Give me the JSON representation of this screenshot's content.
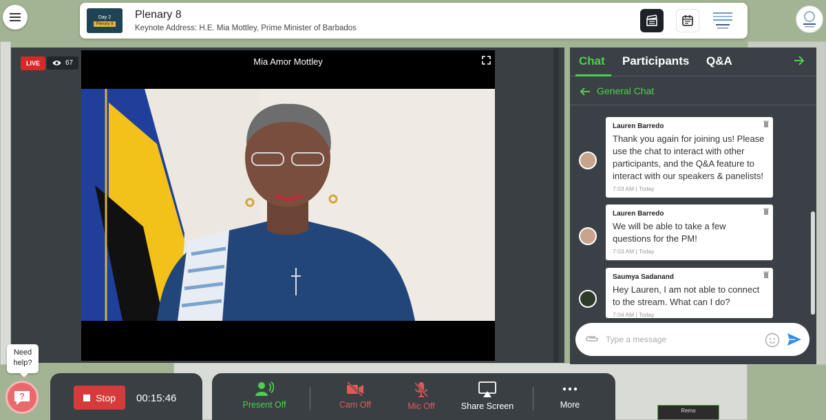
{
  "colors": {
    "accent_green": "#4ccf4c",
    "live_red": "#d52a2a",
    "panel_bg": "#3b4046"
  },
  "header": {
    "thumb_day": "Day 2",
    "thumb_tag": "Plenary 8",
    "title": "Plenary 8",
    "subtitle": "Keynote Address: H.E. Mia Mottley, Prime Minister of Barbados"
  },
  "stage": {
    "live_label": "LIVE",
    "viewer_count": "67",
    "speaker_name": "Mia Amor Mottley"
  },
  "chat": {
    "tabs": [
      "Chat",
      "Participants",
      "Q&A"
    ],
    "active_tab": "Chat",
    "channel": "General Chat",
    "messages": [
      {
        "author": "Lauren Barredo",
        "text": "Thank you again for joining us! Please use the chat to interact with other participants, and the Q&A feature to interact with our speakers & panelists!",
        "time": "7:03 AM | Today"
      },
      {
        "author": "Lauren Barredo",
        "text": "We will be able to take a few questions for the PM!",
        "time": "7:03 AM | Today"
      },
      {
        "author": "Saumya Sadanand",
        "text": "Hey Lauren, I am not able to connect to the stream. What can I do?",
        "time": "7:04 AM | Today"
      }
    ],
    "input_placeholder": "Type a message"
  },
  "help": {
    "label": "Need help?"
  },
  "controls": {
    "stop_label": "Stop",
    "timer": "00:15:46",
    "present": "Present Off",
    "cam": "Cam Off",
    "mic": "Mic Off",
    "share": "Share Screen",
    "more": "More"
  },
  "floor": {
    "tile_label": "Remo"
  },
  "icons": [
    "menu-icon",
    "clapperboard-icon",
    "calendar-icon",
    "eye-icon",
    "expand-icon",
    "arrow-right-icon",
    "arrow-left-icon",
    "trash-icon",
    "paperclip-icon",
    "emoji-icon",
    "send-icon",
    "help-icon",
    "present-icon",
    "cam-off-icon",
    "mic-off-icon",
    "share-screen-icon",
    "more-icon"
  ]
}
